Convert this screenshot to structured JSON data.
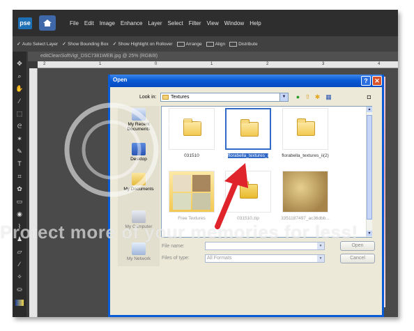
{
  "app": {
    "logo": "pse",
    "menus": [
      "File",
      "Edit",
      "Image",
      "Enhance",
      "Layer",
      "Select",
      "Filter",
      "View",
      "Window",
      "Help"
    ],
    "options": {
      "auto_select": "Auto Select Layer",
      "bounding_box": "Show Bounding Box",
      "highlight": "Show Highlight on Rollover",
      "arrange": "Arrange",
      "align": "Align",
      "distribute": "Distribute"
    },
    "document_tab": "editCleanSoftVigt_DSC7381WEB.jpg @ 25% (RGB/8)",
    "ruler_marks": [
      "2",
      "1",
      "0",
      "1",
      "2",
      "3",
      "4"
    ]
  },
  "dialog": {
    "title": "Open",
    "help_glyph": "?",
    "close_glyph": "✕",
    "look_in_label": "Look in:",
    "look_in_value": "Textures",
    "places": [
      {
        "label": "My Recent Documents",
        "icon": "recent-documents-icon"
      },
      {
        "label": "Desktop",
        "icon": "desktop-icon"
      },
      {
        "label": "My Documents",
        "icon": "my-documents-icon"
      },
      {
        "label": "My Computer",
        "icon": "my-computer-icon"
      },
      {
        "label": "My Network",
        "icon": "my-network-icon"
      }
    ],
    "files": [
      {
        "name": "031510",
        "type": "folder",
        "selected": false
      },
      {
        "name": "florabella_textures_i",
        "type": "folder",
        "selected": true
      },
      {
        "name": "florabella_textures_ii(2)",
        "type": "folder",
        "selected": false
      },
      {
        "name": "Free Textures",
        "type": "folder-thumbnails",
        "selected": false
      },
      {
        "name": "031510.zip",
        "type": "zip",
        "selected": false
      },
      {
        "name": "3351187497_ac36dbb...",
        "type": "image",
        "selected": false
      }
    ],
    "file_name_label": "File name:",
    "file_name_value": "",
    "file_type_label": "Files of type:",
    "file_type_value": "All Formats",
    "open_button": "Open",
    "cancel_button": "Cancel"
  },
  "watermark": {
    "text": "Protect more of your memories for less!"
  },
  "colors": {
    "titlebar": "#0a5bd6",
    "selection": "#3169c6",
    "arrow": "#e0242b",
    "menubar": "#2e2e2e"
  }
}
